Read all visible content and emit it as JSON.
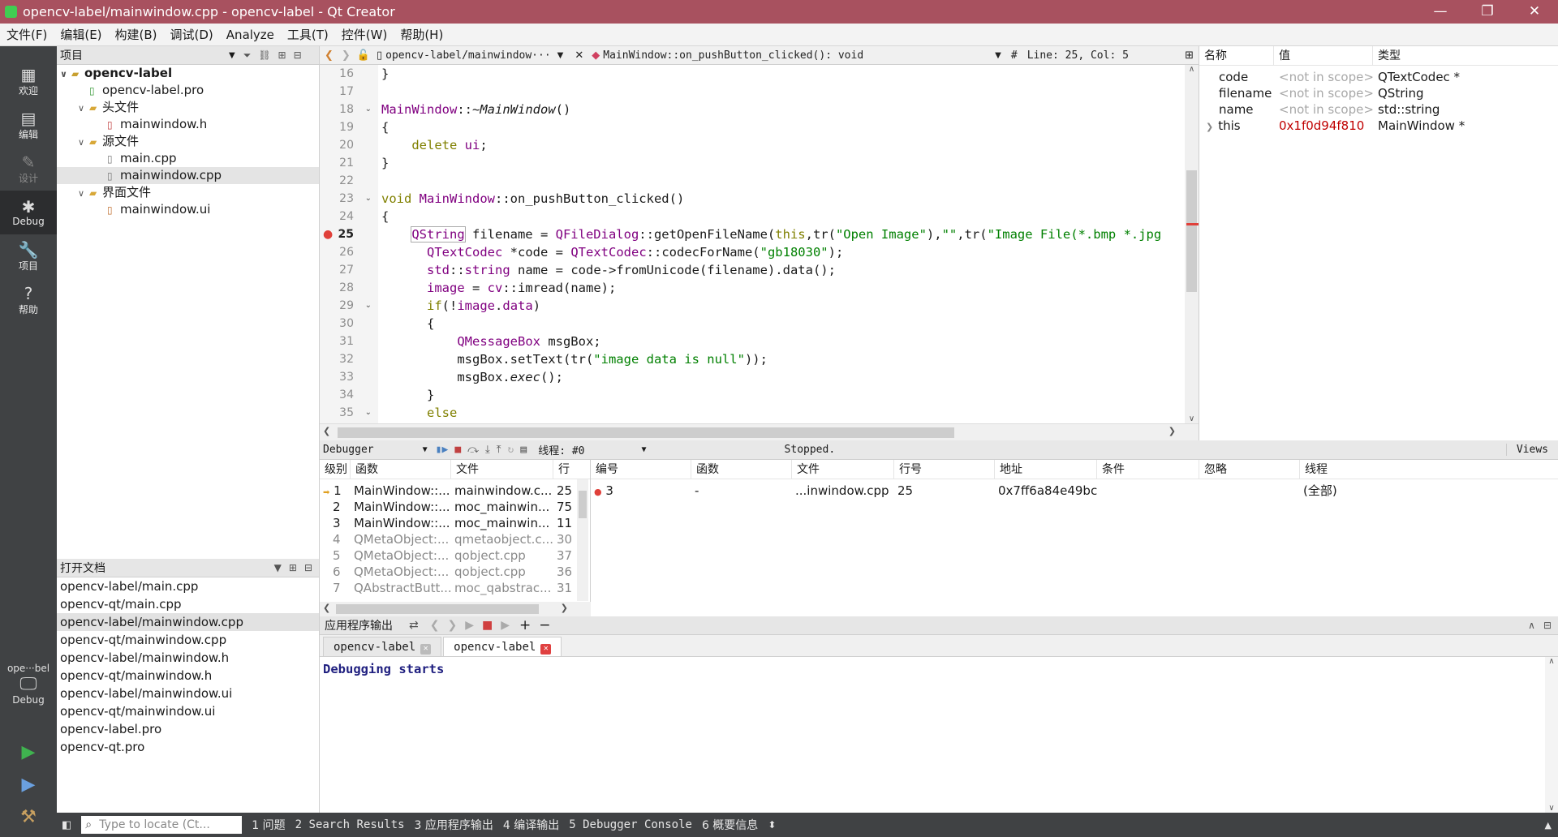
{
  "window": {
    "title": "opencv-label/mainwindow.cpp - opencv-label - Qt Creator",
    "min": "—",
    "max": "❐",
    "close": "✕"
  },
  "menu": [
    "文件(F)",
    "编辑(E)",
    "构建(B)",
    "调试(D)",
    "Analyze",
    "工具(T)",
    "控件(W)",
    "帮助(H)"
  ],
  "modes": [
    {
      "icon": "▦",
      "label": "欢迎"
    },
    {
      "icon": "▤",
      "label": "编辑"
    },
    {
      "icon": "✎",
      "label": "设计"
    },
    {
      "icon": "✱",
      "label": "Debug"
    },
    {
      "icon": "🔧",
      "label": "项目"
    },
    {
      "icon": "?",
      "label": "帮助"
    }
  ],
  "kit": {
    "name": "ope···bel",
    "mode": "Debug"
  },
  "project": {
    "header": "项目",
    "tree": [
      {
        "label": "opencv-label",
        "bold": true
      },
      {
        "label": "opencv-label.pro"
      },
      {
        "label": "头文件"
      },
      {
        "label": "mainwindow.h"
      },
      {
        "label": "源文件"
      },
      {
        "label": "main.cpp"
      },
      {
        "label": "mainwindow.cpp"
      },
      {
        "label": "界面文件"
      },
      {
        "label": "mainwindow.ui"
      }
    ]
  },
  "opendocs": {
    "header": "打开文档",
    "items": [
      "opencv-label/main.cpp",
      "opencv-qt/main.cpp",
      "opencv-label/mainwindow.cpp",
      "opencv-qt/mainwindow.cpp",
      "opencv-label/mainwindow.h",
      "opencv-qt/mainwindow.h",
      "opencv-label/mainwindow.ui",
      "opencv-qt/mainwindow.ui",
      "opencv-label.pro",
      "opencv-qt.pro"
    ]
  },
  "editor": {
    "file": "opencv-label/mainwindow···",
    "symbol": "MainWindow::on_pushButton_clicked(): void",
    "hash": "#",
    "position": "Line: 25, Col: 5",
    "lines": [
      "16",
      "17",
      "18",
      "19",
      "20",
      "21",
      "22",
      "23",
      "24",
      "25",
      "26",
      "27",
      "28",
      "29",
      "30",
      "31",
      "32",
      "33",
      "34",
      "35"
    ]
  },
  "locals": {
    "headers": [
      "名称",
      "值",
      "类型"
    ],
    "rows": [
      {
        "name": "code",
        "value": "<not in scope>",
        "type": "QTextCodec *"
      },
      {
        "name": "filename",
        "value": "<not in scope>",
        "type": "QString"
      },
      {
        "name": "name",
        "value": "<not in scope>",
        "type": "std::string"
      },
      {
        "name": "this",
        "value": "0x1f0d94f810",
        "type": "MainWindow *"
      }
    ]
  },
  "debugger": {
    "label": "Debugger",
    "thread": "线程: #0",
    "status": "Stopped.",
    "views": "Views"
  },
  "stack": {
    "headers": [
      "级别",
      "函数",
      "文件",
      "行"
    ],
    "rows": [
      {
        "level": "1",
        "fn": "MainWindow::...",
        "file": "mainwindow.c...",
        "line": "25"
      },
      {
        "level": "2",
        "fn": "MainWindow::...",
        "file": "moc_mainwin...",
        "line": "75"
      },
      {
        "level": "3",
        "fn": "MainWindow::...",
        "file": "moc_mainwin...",
        "line": "11"
      },
      {
        "level": "4",
        "fn": "QMetaObject:...",
        "file": "qmetaobject.c...",
        "line": "30"
      },
      {
        "level": "5",
        "fn": "QMetaObject:...",
        "file": "qobject.cpp",
        "line": "37"
      },
      {
        "level": "6",
        "fn": "QMetaObject:...",
        "file": "qobject.cpp",
        "line": "36"
      },
      {
        "level": "7",
        "fn": "QAbstractButt...",
        "file": "moc_qabstrac...",
        "line": "31"
      }
    ]
  },
  "breakpoints": {
    "headers": [
      "编号",
      "函数",
      "文件",
      "行号",
      "地址",
      "条件",
      "忽略",
      "线程"
    ],
    "rows": [
      {
        "num": "3",
        "fn": "-",
        "file": "...inwindow.cpp",
        "line": "25",
        "addr": "0x7ff6a84e49bc",
        "cond": "",
        "ignore": "",
        "thread": "(全部)"
      }
    ]
  },
  "output": {
    "header": "应用程序输出",
    "tabs": [
      "opencv-label",
      "opencv-label"
    ],
    "text": "Debugging starts"
  },
  "status": {
    "locate_placeholder": "Type to locate (Ct...",
    "items": [
      "1 问题",
      "2 Search Results",
      "3 应用程序输出",
      "4 编译输出",
      "5 Debugger Console",
      "6 概要信息"
    ]
  },
  "colors": {
    "titlebar": "#a8515f",
    "modebar": "#404244",
    "breakpoint": "#e0403a"
  }
}
